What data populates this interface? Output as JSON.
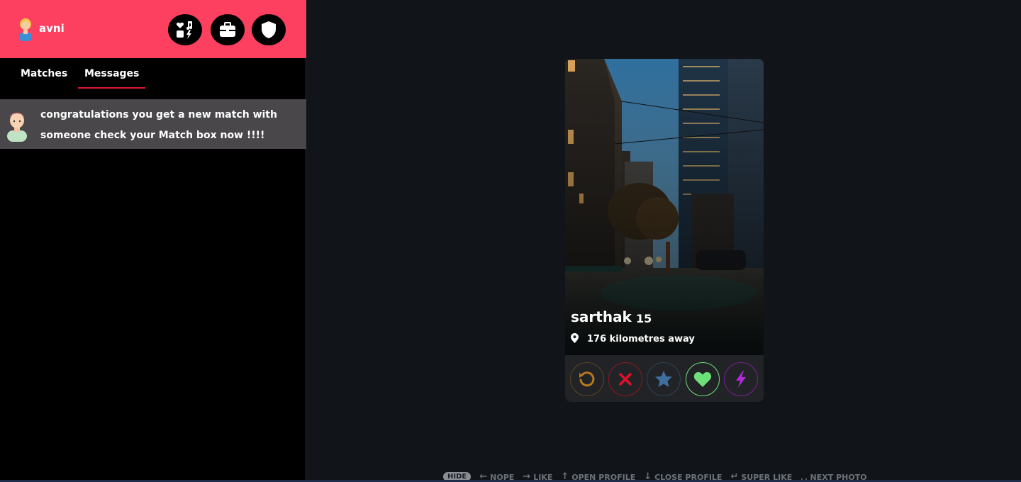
{
  "sidebar": {
    "user_name": "avni",
    "header_buttons": [
      "tinder-explore-icon",
      "briefcase-icon",
      "shield-icon"
    ],
    "tabs": [
      {
        "label": "Matches",
        "active": false
      },
      {
        "label": "Messages",
        "active": true
      }
    ],
    "messages": [
      {
        "text": "congratulations you get a new match with someone check your Match box now !!!!"
      }
    ]
  },
  "card": {
    "name": "sarthak",
    "age": "15",
    "distance": "176 kilometres away",
    "actions": [
      "rewind-icon",
      "nope-icon",
      "super-like-icon",
      "like-icon",
      "boost-icon"
    ]
  },
  "shortcuts": {
    "hide_label": "HIDE",
    "items": [
      {
        "glyph": "←",
        "label": "NOPE"
      },
      {
        "glyph": "→",
        "label": "LIKE"
      },
      {
        "glyph": "↑",
        "label": "OPEN PROFILE"
      },
      {
        "glyph": "↓",
        "label": "CLOSE PROFILE"
      },
      {
        "glyph": "↵",
        "label": "SUPER LIKE"
      },
      {
        "glyph": "␣",
        "label": "NEXT PHOTO"
      }
    ]
  },
  "colors": {
    "brand": "#fd4060",
    "rewind": "#b7791f",
    "nope": "#e0102b",
    "super_like": "#3f6f9e",
    "like": "#6ee07a",
    "boost": "#b12bd8"
  }
}
